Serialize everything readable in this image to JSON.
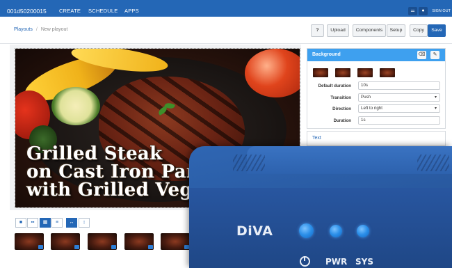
{
  "nav": {
    "brand": "001d50200015",
    "items": [
      "CREATE",
      "SCHEDULE",
      "APPS"
    ],
    "signout": "SIGN OUT"
  },
  "breadcrumb": {
    "parent": "Playouts",
    "separator": "/",
    "current": "New playout"
  },
  "toolbar": {
    "help": "?",
    "upload": "Upload",
    "components": "Components",
    "setup": "Setup",
    "copy": "Copy",
    "save": "Save"
  },
  "preview": {
    "caption_lines": [
      "Grilled Steak",
      "on Cast Iron Pan",
      "with Grilled Veg"
    ]
  },
  "view_buttons": [
    "single-view-icon",
    "grid-2-icon",
    "grid-4-icon",
    "list-icon",
    "fit-width-icon",
    "fit-height-icon"
  ],
  "thumbnails_count": 6,
  "side_panel": {
    "title": "Background",
    "fields": [
      {
        "label": "Default duration",
        "value": "10s",
        "type": "input"
      },
      {
        "label": "Transition",
        "value": "Push",
        "type": "select"
      },
      {
        "label": "Direction",
        "value": "Left to right",
        "type": "select"
      },
      {
        "label": "Duration",
        "value": "1s",
        "type": "input"
      }
    ],
    "text_section": "Text"
  },
  "device": {
    "brand": "DiVA",
    "labels": [
      "PWR",
      "SYS"
    ]
  },
  "colors": {
    "accent": "#2467b6",
    "panel_header": "#3ea0ef",
    "device": "#2a5ca4"
  }
}
